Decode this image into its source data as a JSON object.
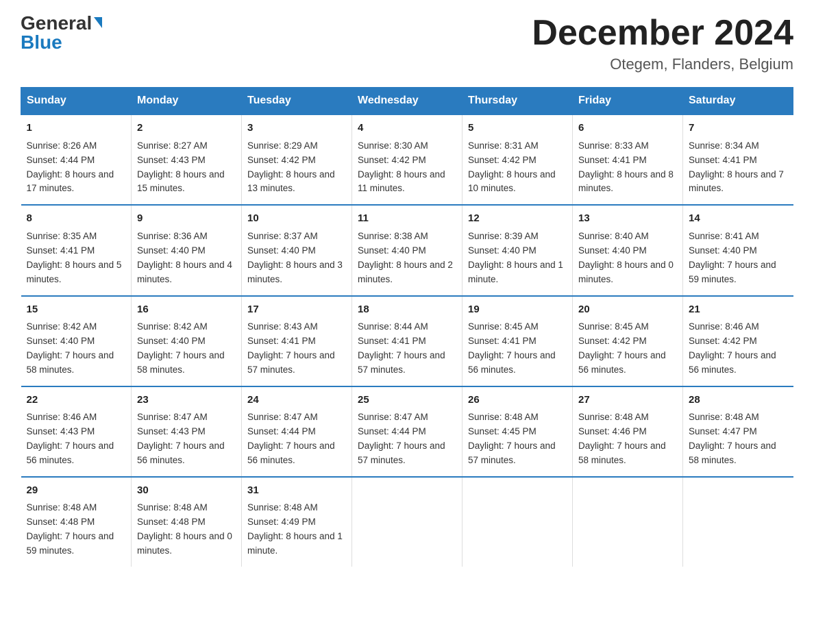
{
  "logo": {
    "general": "General",
    "blue": "Blue",
    "triangle": "▶"
  },
  "title": {
    "month_year": "December 2024",
    "location": "Otegem, Flanders, Belgium"
  },
  "days_of_week": [
    "Sunday",
    "Monday",
    "Tuesday",
    "Wednesday",
    "Thursday",
    "Friday",
    "Saturday"
  ],
  "weeks": [
    [
      {
        "num": "1",
        "sunrise": "8:26 AM",
        "sunset": "4:44 PM",
        "daylight": "8 hours and 17 minutes."
      },
      {
        "num": "2",
        "sunrise": "8:27 AM",
        "sunset": "4:43 PM",
        "daylight": "8 hours and 15 minutes."
      },
      {
        "num": "3",
        "sunrise": "8:29 AM",
        "sunset": "4:42 PM",
        "daylight": "8 hours and 13 minutes."
      },
      {
        "num": "4",
        "sunrise": "8:30 AM",
        "sunset": "4:42 PM",
        "daylight": "8 hours and 11 minutes."
      },
      {
        "num": "5",
        "sunrise": "8:31 AM",
        "sunset": "4:42 PM",
        "daylight": "8 hours and 10 minutes."
      },
      {
        "num": "6",
        "sunrise": "8:33 AM",
        "sunset": "4:41 PM",
        "daylight": "8 hours and 8 minutes."
      },
      {
        "num": "7",
        "sunrise": "8:34 AM",
        "sunset": "4:41 PM",
        "daylight": "8 hours and 7 minutes."
      }
    ],
    [
      {
        "num": "8",
        "sunrise": "8:35 AM",
        "sunset": "4:41 PM",
        "daylight": "8 hours and 5 minutes."
      },
      {
        "num": "9",
        "sunrise": "8:36 AM",
        "sunset": "4:40 PM",
        "daylight": "8 hours and 4 minutes."
      },
      {
        "num": "10",
        "sunrise": "8:37 AM",
        "sunset": "4:40 PM",
        "daylight": "8 hours and 3 minutes."
      },
      {
        "num": "11",
        "sunrise": "8:38 AM",
        "sunset": "4:40 PM",
        "daylight": "8 hours and 2 minutes."
      },
      {
        "num": "12",
        "sunrise": "8:39 AM",
        "sunset": "4:40 PM",
        "daylight": "8 hours and 1 minute."
      },
      {
        "num": "13",
        "sunrise": "8:40 AM",
        "sunset": "4:40 PM",
        "daylight": "8 hours and 0 minutes."
      },
      {
        "num": "14",
        "sunrise": "8:41 AM",
        "sunset": "4:40 PM",
        "daylight": "7 hours and 59 minutes."
      }
    ],
    [
      {
        "num": "15",
        "sunrise": "8:42 AM",
        "sunset": "4:40 PM",
        "daylight": "7 hours and 58 minutes."
      },
      {
        "num": "16",
        "sunrise": "8:42 AM",
        "sunset": "4:40 PM",
        "daylight": "7 hours and 58 minutes."
      },
      {
        "num": "17",
        "sunrise": "8:43 AM",
        "sunset": "4:41 PM",
        "daylight": "7 hours and 57 minutes."
      },
      {
        "num": "18",
        "sunrise": "8:44 AM",
        "sunset": "4:41 PM",
        "daylight": "7 hours and 57 minutes."
      },
      {
        "num": "19",
        "sunrise": "8:45 AM",
        "sunset": "4:41 PM",
        "daylight": "7 hours and 56 minutes."
      },
      {
        "num": "20",
        "sunrise": "8:45 AM",
        "sunset": "4:42 PM",
        "daylight": "7 hours and 56 minutes."
      },
      {
        "num": "21",
        "sunrise": "8:46 AM",
        "sunset": "4:42 PM",
        "daylight": "7 hours and 56 minutes."
      }
    ],
    [
      {
        "num": "22",
        "sunrise": "8:46 AM",
        "sunset": "4:43 PM",
        "daylight": "7 hours and 56 minutes."
      },
      {
        "num": "23",
        "sunrise": "8:47 AM",
        "sunset": "4:43 PM",
        "daylight": "7 hours and 56 minutes."
      },
      {
        "num": "24",
        "sunrise": "8:47 AM",
        "sunset": "4:44 PM",
        "daylight": "7 hours and 56 minutes."
      },
      {
        "num": "25",
        "sunrise": "8:47 AM",
        "sunset": "4:44 PM",
        "daylight": "7 hours and 57 minutes."
      },
      {
        "num": "26",
        "sunrise": "8:48 AM",
        "sunset": "4:45 PM",
        "daylight": "7 hours and 57 minutes."
      },
      {
        "num": "27",
        "sunrise": "8:48 AM",
        "sunset": "4:46 PM",
        "daylight": "7 hours and 58 minutes."
      },
      {
        "num": "28",
        "sunrise": "8:48 AM",
        "sunset": "4:47 PM",
        "daylight": "7 hours and 58 minutes."
      }
    ],
    [
      {
        "num": "29",
        "sunrise": "8:48 AM",
        "sunset": "4:48 PM",
        "daylight": "7 hours and 59 minutes."
      },
      {
        "num": "30",
        "sunrise": "8:48 AM",
        "sunset": "4:48 PM",
        "daylight": "8 hours and 0 minutes."
      },
      {
        "num": "31",
        "sunrise": "8:48 AM",
        "sunset": "4:49 PM",
        "daylight": "8 hours and 1 minute."
      },
      null,
      null,
      null,
      null
    ]
  ]
}
